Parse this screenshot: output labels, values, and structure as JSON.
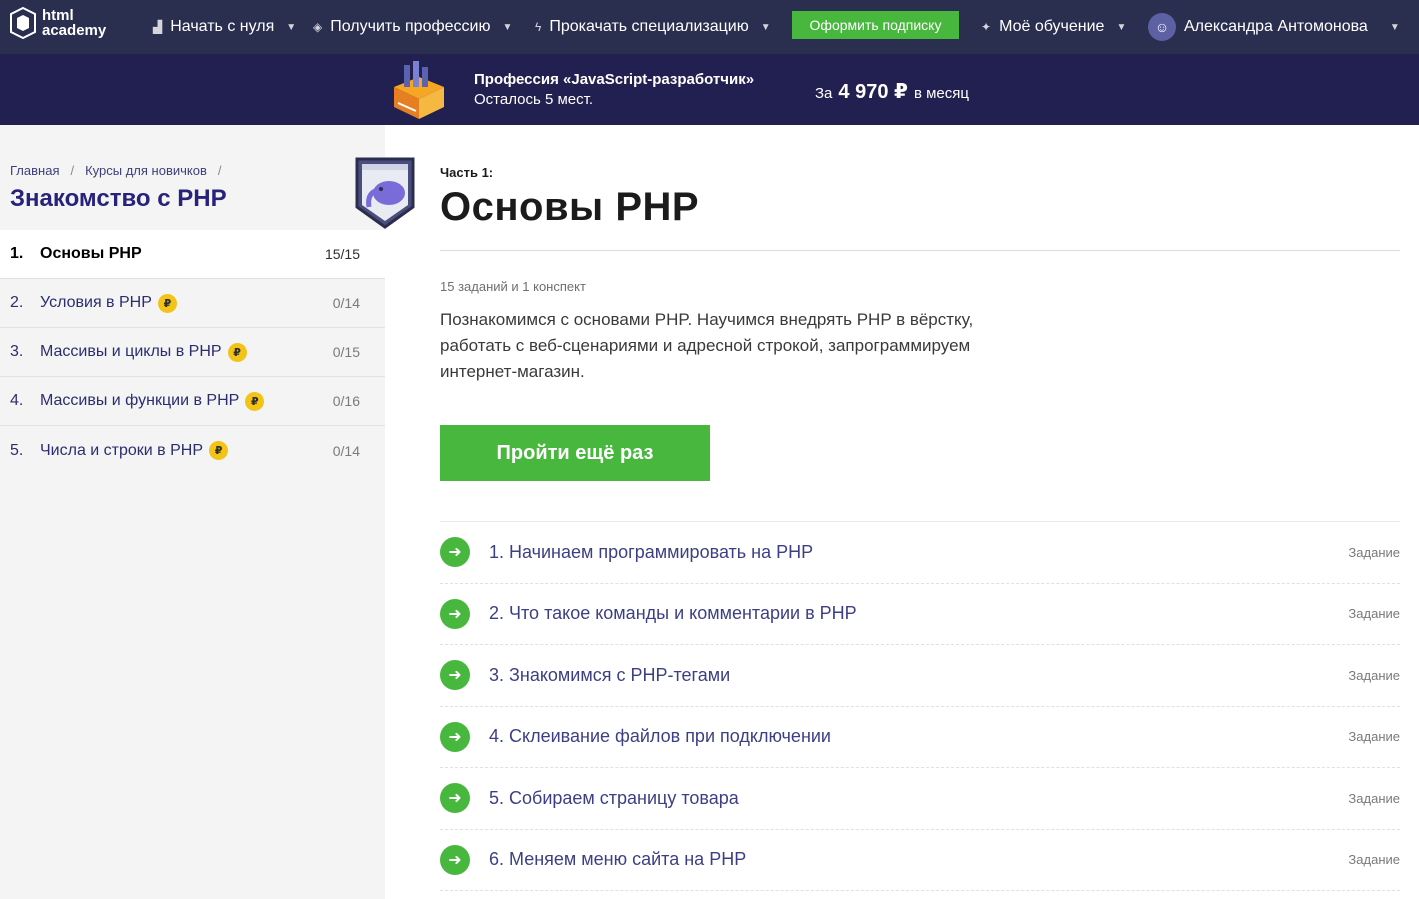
{
  "nav": {
    "logo_line1": "html",
    "logo_line2": "academy",
    "items": [
      {
        "label": "Начать с нуля"
      },
      {
        "label": "Получить профессию"
      },
      {
        "label": "Прокачать специализацию"
      }
    ],
    "subscribe_label": "Оформить подписку",
    "learning_label": "Моё обучение",
    "user_name": "Александра Антомонова"
  },
  "promo": {
    "title": "Профессия «JavaScript-разработчик»",
    "subtitle": "Осталось 5 мест.",
    "price_prefix": "За",
    "price": "4 970 ₽",
    "price_suffix": "в месяц"
  },
  "sidebar": {
    "breadcrumbs": [
      "Главная",
      "Курсы для новичков"
    ],
    "course_title": "Знакомство с PHP",
    "lessons": [
      {
        "num": "1.",
        "title": "Основы PHP",
        "paid": false,
        "progress": "15/15"
      },
      {
        "num": "2.",
        "title": "Условия в PHP",
        "paid": true,
        "progress": "0/14"
      },
      {
        "num": "3.",
        "title": "Массивы и циклы в PHP",
        "paid": true,
        "progress": "0/15"
      },
      {
        "num": "4.",
        "title": "Массивы и функции в PHP",
        "paid": true,
        "progress": "0/16"
      },
      {
        "num": "5.",
        "title": "Числа и строки в PHP",
        "paid": true,
        "progress": "0/14"
      }
    ]
  },
  "main": {
    "part_label": "Часть 1:",
    "part_title": "Основы PHP",
    "count": "15 заданий и 1 конспект",
    "description": "Познакомимся с основами PHP. Научимся внедрять PHP в вёрстку, работать с веб-сценариями и адресной строкой, запрограммируем интернет-магазин.",
    "repeat_label": "Пройти ещё раз",
    "tasks": [
      {
        "title": "1. Начинаем программировать на PHP",
        "type": "Задание"
      },
      {
        "title": "2. Что такое команды и комментарии в PHP",
        "type": "Задание"
      },
      {
        "title": "3. Знакомимся с PHP-тегами",
        "type": "Задание"
      },
      {
        "title": "4. Склеивание файлов при подключении",
        "type": "Задание"
      },
      {
        "title": "5. Собираем страницу товара",
        "type": "Задание"
      },
      {
        "title": "6. Меняем меню сайта на PHP",
        "type": "Задание"
      }
    ]
  },
  "colors": {
    "nav_bg": "#2a2e4f",
    "promo_bg": "#222050",
    "accent_green": "#48b73e",
    "coin": "#f3c318"
  }
}
